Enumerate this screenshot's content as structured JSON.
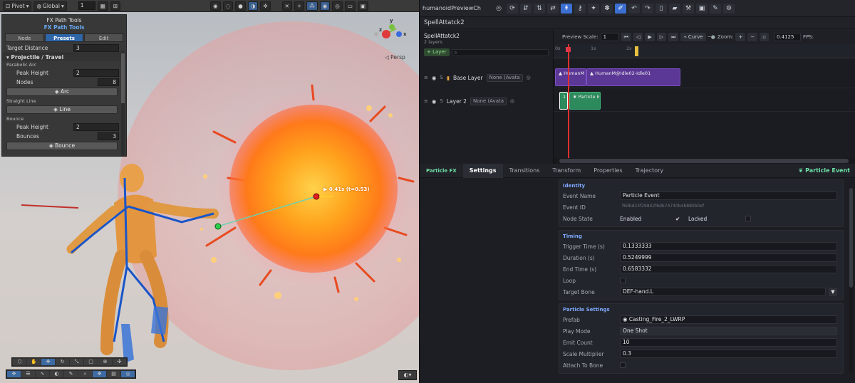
{
  "scene": {
    "toolbar": {
      "pivot": "Pivot",
      "global": "Global",
      "snap_value": "1"
    },
    "fx_panel": {
      "title": "FX Path Tools",
      "subtitle": "FX Path Tools",
      "tabs": [
        "Node",
        "Presets",
        "Edit"
      ],
      "active_tab": "Presets",
      "target_distance_label": "Target Distance",
      "target_distance": "3",
      "section": "Projectile / Travel",
      "parabolic": {
        "group": "Parabolic Arc",
        "peak_height_label": "Peak Height",
        "peak_height": "2",
        "nodes_label": "Nodes",
        "nodes": "8",
        "button": "◈ Arc"
      },
      "straight": {
        "group": "Straight Line",
        "button": "◈ Line"
      },
      "bounce": {
        "group": "Bounce",
        "peak_height_label": "Peak Height",
        "peak_height": "2",
        "bounces_label": "Bounces",
        "bounces": "3",
        "button": "◈ Bounce"
      }
    },
    "persp_label": "◁ Persp",
    "gizmo": {
      "x": "x",
      "y": "y",
      "z": "z"
    },
    "time_marker": "▶ 0.41s  (t=0.53)"
  },
  "anim": {
    "window_title": "humanoidPreviewCh",
    "tab_title": "SpellAttatck2",
    "clip_name": "SpellAttatck2",
    "clip_layers": "2 layers",
    "add_layer": "+ Layer",
    "layers": [
      {
        "name": "Base Layer",
        "mask": "None (Avata",
        "s": "S"
      },
      {
        "name": "Layer 2",
        "mask": "None (Avata",
        "s": "S"
      }
    ],
    "controls": {
      "preview_scale_label": "Preview Scale:",
      "preview_scale": "1",
      "curve": "⌁ Curve",
      "zoom_label": "Zoom:",
      "time": "0.4125",
      "fps_label": "FPS:"
    },
    "ruler": [
      "0s",
      "1s",
      "2s"
    ],
    "clips": {
      "base_a": "▲ HumanM",
      "base_b": "▲ HumanM@Idle02-Idle01",
      "layer2_a": "1",
      "layer2_b": "❦ Particle Eve"
    }
  },
  "inspector": {
    "tabs": [
      "Particle FX",
      "Settings",
      "Transitions",
      "Transform",
      "Properties",
      "Trajectory"
    ],
    "active_tab": "Settings",
    "right_label": "❦ Particle Event",
    "identity": {
      "title": "Identity",
      "event_name_label": "Event Name",
      "event_name": "Particle Event",
      "event_id_label": "Event ID",
      "event_id": "f6dbd23f29842f6db74740b4b880b0ef",
      "node_state_label": "Node State",
      "enabled": "Enabled",
      "check": "✔",
      "locked": "Locked"
    },
    "timing": {
      "title": "Timing",
      "trigger_label": "Trigger Time (s)",
      "trigger": "0.1333333",
      "duration_label": "Duration (s)",
      "duration": "0.5249999",
      "end_label": "End Time (s)",
      "end": "0.6583332",
      "loop_label": "Loop",
      "bone_label": "Target Bone",
      "bone": "DEF-hand.L"
    },
    "particle": {
      "title": "Particle Settings",
      "prefab_label": "Prefab",
      "prefab": "◉ Casting_Fire_2_LWRP",
      "play_mode_label": "Play Mode",
      "play_mode": "One Shot",
      "emit_label": "Emit Count",
      "emit": "10",
      "scale_label": "Scale Multiplier",
      "scale": "0.3",
      "attach_label": "Attach To Bone"
    }
  },
  "colors": {
    "accent": "#3c6fd1",
    "event_green": "#6fe0a8",
    "anim_clip": "#5b3796",
    "event_clip": "#2c8a5c",
    "playhead": "#e03030",
    "fire": "#ff8a1a"
  }
}
